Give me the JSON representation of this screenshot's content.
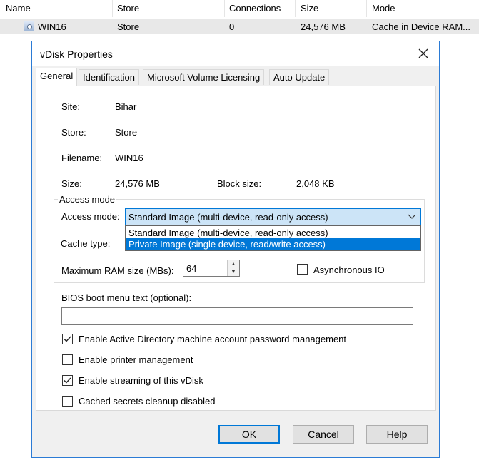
{
  "list": {
    "headers": [
      "Name",
      "Store",
      "Connections",
      "Size",
      "Mode"
    ],
    "row": {
      "name": "WIN16",
      "store": "Store",
      "connections": "0",
      "size": "24,576 MB",
      "mode": "Cache in Device RAM..."
    }
  },
  "dialog": {
    "title": "vDisk Properties",
    "close_icon": "close-icon",
    "tabs": [
      "General",
      "Identification",
      "Microsoft Volume Licensing",
      "Auto Update"
    ],
    "active_tab": "General",
    "general": {
      "site_label": "Site:",
      "site_value": "Bihar",
      "store_label": "Store:",
      "store_value": "Store",
      "filename_label": "Filename:",
      "filename_value": "WIN16",
      "size_label": "Size:",
      "size_value": "24,576 MB",
      "block_size_label": "Block size:",
      "block_size_value": "2,048 KB",
      "access_group_label": "Access mode",
      "access_mode_label": "Access mode:",
      "access_mode_selected": "Standard Image (multi-device, read-only access)",
      "access_mode_options": [
        "Standard Image (multi-device, read-only access)",
        "Private Image (single device, read/write access)"
      ],
      "highlighted_option": "Private Image (single device, read/write access)",
      "cache_type_label": "Cache type:",
      "max_ram_label": "Maximum RAM size (MBs):",
      "max_ram_value": "64",
      "async_io_label": "Asynchronous IO",
      "async_io_checked": false,
      "bios_label": "BIOS boot menu text (optional):",
      "bios_value": "",
      "checkboxes": [
        {
          "label": "Enable Active Directory machine account password management",
          "checked": true
        },
        {
          "label": "Enable printer management",
          "checked": false
        },
        {
          "label": "Enable streaming of this vDisk",
          "checked": true
        },
        {
          "label": "Cached secrets cleanup disabled",
          "checked": false
        }
      ]
    },
    "buttons": {
      "ok": "OK",
      "cancel": "Cancel",
      "help": "Help"
    },
    "colors": {
      "accent": "#0078d7",
      "selection": "#0078d7",
      "combo_background": "#cce4f7"
    }
  }
}
